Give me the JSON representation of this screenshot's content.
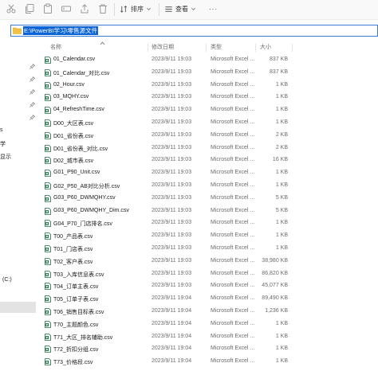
{
  "toolbar": {
    "sort_label": "排序",
    "view_label": "查看",
    "more_label": "···"
  },
  "address": {
    "path": "E:\\PowerBI学习\\零售源文件"
  },
  "nav": {
    "labels": [
      "学",
      "显示",
      "(C:)"
    ]
  },
  "columns": {
    "name": "名称",
    "date": "修改日期",
    "type": "类型",
    "size": "大小"
  },
  "files": [
    {
      "name": "01_Calendar.csv",
      "date": "2023/9/11 19:03",
      "type": "Microsoft Excel ...",
      "size": "837 KB"
    },
    {
      "name": "01_Calendar_对比.csv",
      "date": "2023/9/11 19:03",
      "type": "Microsoft Excel ...",
      "size": "837 KB"
    },
    {
      "name": "02_Hour.csv",
      "date": "2023/9/11 19:03",
      "type": "Microsoft Excel ...",
      "size": "1 KB"
    },
    {
      "name": "03_MQHY.csv",
      "date": "2023/9/11 19:03",
      "type": "Microsoft Excel ...",
      "size": "1 KB"
    },
    {
      "name": "04_RefreshTime.csv",
      "date": "2023/9/11 19:03",
      "type": "Microsoft Excel ...",
      "size": "1 KB"
    },
    {
      "name": "D00_大区表.csv",
      "date": "2023/9/11 19:03",
      "type": "Microsoft Excel ...",
      "size": "1 KB"
    },
    {
      "name": "D01_省份表.csv",
      "date": "2023/9/11 19:03",
      "type": "Microsoft Excel ...",
      "size": "2 KB"
    },
    {
      "name": "D01_省份表_对比.csv",
      "date": "2023/9/11 19:03",
      "type": "Microsoft Excel ...",
      "size": "2 KB"
    },
    {
      "name": "D02_城市表.csv",
      "date": "2023/9/11 19:03",
      "type": "Microsoft Excel ...",
      "size": "16 KB"
    },
    {
      "name": "G01_P90_Unit.csv",
      "date": "2023/9/11 19:03",
      "type": "Microsoft Excel ...",
      "size": "1 KB"
    },
    {
      "name": "G02_P50_AB对比分析.csv",
      "date": "2023/9/11 19:03",
      "type": "Microsoft Excel ...",
      "size": "1 KB"
    },
    {
      "name": "G03_P60_DWMQHY.csv",
      "date": "2023/9/11 19:03",
      "type": "Microsoft Excel ...",
      "size": "5 KB"
    },
    {
      "name": "G03_P60_DWMQHY_Dim.csv",
      "date": "2023/9/11 19:03",
      "type": "Microsoft Excel ...",
      "size": "5 KB"
    },
    {
      "name": "G04_P70_门店排名.csv",
      "date": "2023/9/11 19:03",
      "type": "Microsoft Excel ...",
      "size": "1 KB"
    },
    {
      "name": "T00_产品表.csv",
      "date": "2023/9/11 19:03",
      "type": "Microsoft Excel ...",
      "size": "1 KB"
    },
    {
      "name": "T01_门店表.csv",
      "date": "2023/9/11 19:03",
      "type": "Microsoft Excel ...",
      "size": "1 KB"
    },
    {
      "name": "T02_客户表.csv",
      "date": "2023/9/11 19:03",
      "type": "Microsoft Excel ...",
      "size": "38,980 KB"
    },
    {
      "name": "T03_入库信息表.csv",
      "date": "2023/9/11 19:03",
      "type": "Microsoft Excel ...",
      "size": "86,820 KB"
    },
    {
      "name": "T04_订单主表.csv",
      "date": "2023/9/11 19:03",
      "type": "Microsoft Excel ...",
      "size": "45,077 KB"
    },
    {
      "name": "T05_订单子表.csv",
      "date": "2023/9/11 19:04",
      "type": "Microsoft Excel ...",
      "size": "89,490 KB"
    },
    {
      "name": "T06_销售目标表.csv",
      "date": "2023/9/11 19:04",
      "type": "Microsoft Excel ...",
      "size": "1,236 KB"
    },
    {
      "name": "T70_主题颜色.csv",
      "date": "2023/9/11 19:04",
      "type": "Microsoft Excel ...",
      "size": "1 KB"
    },
    {
      "name": "T71_大区_排名辅助.csv",
      "date": "2023/9/11 19:04",
      "type": "Microsoft Excel ...",
      "size": "1 KB"
    },
    {
      "name": "T72_折扣分组.csv",
      "date": "2023/9/11 19:04",
      "type": "Microsoft Excel ...",
      "size": "1 KB"
    },
    {
      "name": "T73_价格段.csv",
      "date": "2023/9/11 19:04",
      "type": "Microsoft Excel ...",
      "size": "1 KB"
    }
  ]
}
